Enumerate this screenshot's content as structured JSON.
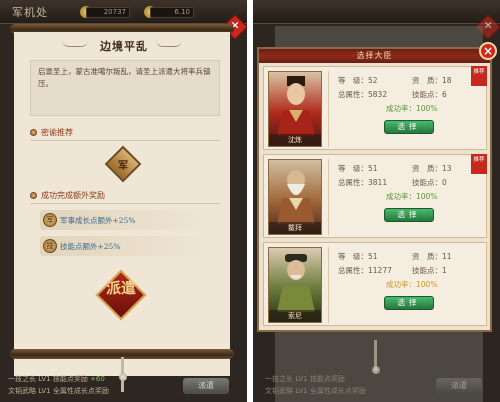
{
  "left": {
    "topbar": {
      "title": "军机处",
      "res1": "20737",
      "res2": "6.10"
    },
    "scroll": {
      "title": "边境平乱",
      "description": "启禀圣上，蒙古准噶尔叛乱，请圣上派遣大将率兵镇压。",
      "recommend_label": "密谕推荐",
      "recommend_seal": "军",
      "bonus_label": "成功完成额外奖励",
      "bonuses": [
        {
          "icon": "军",
          "text": "军事成长点额外+25%"
        },
        {
          "icon": "技",
          "text": "技能点额外+25%"
        }
      ],
      "dispatch_stamp": "派遣"
    },
    "bottom": {
      "line1_prefix": "一技之长 LV1 技能点奖励 ",
      "line1_value": "+60",
      "line2": "文韬武略 LV1 全属性成长点奖励",
      "button": "派遣"
    }
  },
  "right": {
    "modal_title": "选择大臣",
    "generals": [
      {
        "name": "沈炼",
        "level_label": "等　级：",
        "level": "52",
        "quality_label": "资　质：",
        "quality": "18",
        "power_label": "总属性：",
        "power": "5832",
        "skill_label": "技能点：",
        "skill": "6",
        "rate_label": "成功率：",
        "rate": "100%",
        "button": "选择",
        "recommend": "推荐"
      },
      {
        "name": "鳌拜",
        "level_label": "等　级：",
        "level": "51",
        "quality_label": "资　质：",
        "quality": "13",
        "power_label": "总属性：",
        "power": "3811",
        "skill_label": "技能点：",
        "skill": "0",
        "rate_label": "成功率：",
        "rate": "100%",
        "button": "选择",
        "recommend": "推荐"
      },
      {
        "name": "索尼",
        "level_label": "等　级：",
        "level": "51",
        "quality_label": "资　质：",
        "quality": "11",
        "power_label": "总属性：",
        "power": "11277",
        "skill_label": "技能点：",
        "skill": "1",
        "rate_label": "成功率：",
        "rate": "100%",
        "button": "选择",
        "recommend": ""
      }
    ],
    "bottom": {
      "line1": "一技之长 LV1 技能点奖励",
      "line2": "文韬武略 LV1 全属性成长点奖励",
      "button": "派遣"
    }
  }
}
